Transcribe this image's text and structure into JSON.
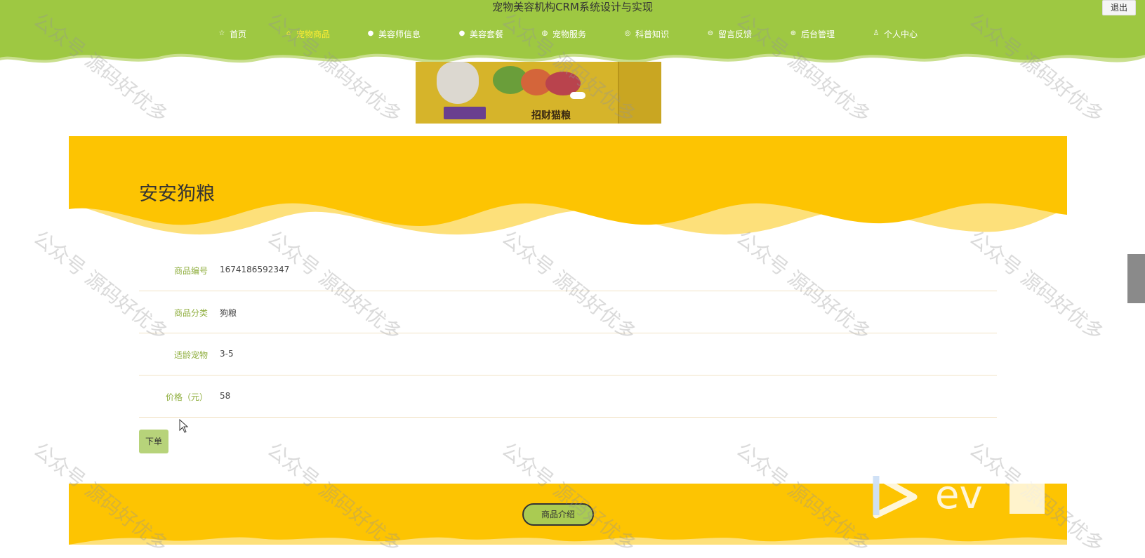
{
  "header": {
    "site_title": "宠物美容机构CRM系统设计与实现",
    "logout_label": "退出",
    "nav": [
      {
        "label": "首页",
        "icon": "star-icon",
        "active": false
      },
      {
        "label": "宠物商品",
        "icon": "shopping-bag-icon",
        "active": true
      },
      {
        "label": "美容师信息",
        "icon": "info-icon",
        "active": false
      },
      {
        "label": "美容套餐",
        "icon": "help-icon",
        "active": false
      },
      {
        "label": "宠物服务",
        "icon": "globe-icon",
        "active": false
      },
      {
        "label": "科普知识",
        "icon": "world-icon",
        "active": false
      },
      {
        "label": "留言反馈",
        "icon": "message-icon",
        "active": false
      },
      {
        "label": "后台管理",
        "icon": "admin-icon",
        "active": false
      },
      {
        "label": "个人中心",
        "icon": "user-icon",
        "active": false
      }
    ]
  },
  "banner": {
    "pack_label": "招财猫粮"
  },
  "product": {
    "title": "安安狗粮",
    "fields": [
      {
        "label": "商品编号",
        "value": "1674186592347"
      },
      {
        "label": "商品分类",
        "value": "狗粮"
      },
      {
        "label": "适龄宠物",
        "value": "3-5"
      },
      {
        "label": "价格（元）",
        "value": "58"
      }
    ],
    "order_label": "下单"
  },
  "intro": {
    "button_label": "商品介绍"
  },
  "watermark_text": "公众号 源码好优多",
  "colors": {
    "header_green": "#9ec842",
    "accent_yellow": "#fdc402",
    "wave_light": "#fde07a",
    "label_green": "#8fae3e"
  }
}
